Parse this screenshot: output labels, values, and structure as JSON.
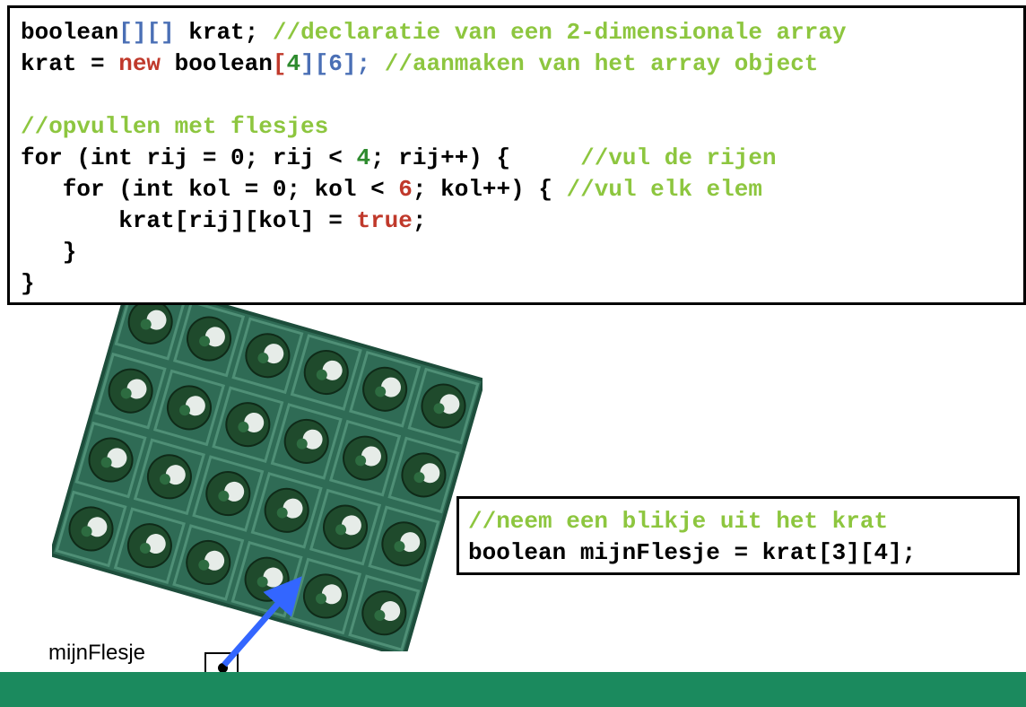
{
  "code_main": {
    "line1": {
      "a": "boolean",
      "b": "[][]",
      "c": " krat; ",
      "d": "//declaratie van een 2-dimensionale array"
    },
    "line2": {
      "a": "krat = ",
      "b": "new",
      "c": " boolean",
      "d": "[",
      "e": "4",
      "f": "][",
      "g": "6",
      "h": "]",
      "i": "; ",
      "j": "//aanmaken van het array object"
    },
    "line4": {
      "a": "//opvullen met flesjes"
    },
    "line5": {
      "a": "for (int rij = 0; rij < ",
      "b": "4",
      "c": "; rij++) {     ",
      "d": "//vul de rijen"
    },
    "line6": {
      "a": "   for (int kol = 0; kol < ",
      "b": "6",
      "c": "; kol++) { ",
      "d": "//vul elk elem"
    },
    "line7": {
      "a": "       krat[rij][kol] = ",
      "b": "true",
      "c": ";"
    },
    "line8": {
      "a": "   }"
    },
    "line9": {
      "a": "}"
    }
  },
  "code_side": {
    "line1": "//neem een blikje uit het krat",
    "line2": "boolean mijnFlesje = krat[3][4];"
  },
  "variable_label": "mijnFlesje",
  "colors": {
    "comment": "#8dc63f",
    "keyword": "#c0392b",
    "bracket": "#4a6fb5",
    "number": "#2e8b2e",
    "crate": "#2f6b55",
    "arrow": "#3366ff",
    "footer": "#1b8a5e"
  }
}
